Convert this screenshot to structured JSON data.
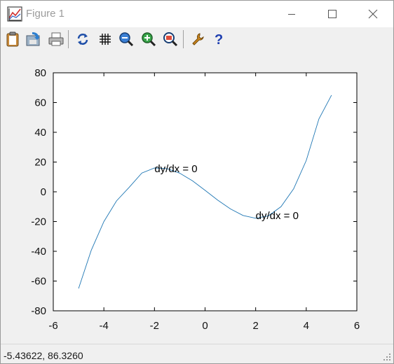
{
  "window": {
    "title": "Figure 1"
  },
  "titlebar_buttons": {
    "minimize": "minimize-icon",
    "maximize": "maximize-icon",
    "close": "close-icon"
  },
  "toolbar": {
    "items": [
      "copy-clipboard-icon",
      "save-icon",
      "print-icon",
      "refresh-icon",
      "grid-icon",
      "zoom-out-icon",
      "zoom-in-icon",
      "zoom-box-icon",
      "settings-wrench-icon",
      "help-icon"
    ]
  },
  "colors": {
    "line": "#1f77b4",
    "background": "#f0f0f0",
    "axes_face": "#ffffff"
  },
  "chart_data": {
    "type": "line",
    "title": "",
    "xlabel": "",
    "ylabel": "",
    "xlim": [
      -6,
      6
    ],
    "ylim": [
      -80,
      80
    ],
    "xticks": [
      "-6",
      "-4",
      "-2",
      "0",
      "2",
      "4",
      "6"
    ],
    "yticks": [
      "80",
      "60",
      "40",
      "20",
      "0",
      "-20",
      "-40",
      "-60",
      "-80"
    ],
    "grid": false,
    "series": [
      {
        "x": [
          -5,
          -4.5,
          -4,
          -3.5,
          -3,
          -2.5,
          -2,
          -1.5,
          -1,
          -0.5,
          0,
          0.5,
          1,
          1.5,
          2,
          2.5,
          3,
          3.5,
          4,
          4.5,
          5
        ],
        "y": [
          -65,
          -39.4,
          -20,
          -6.1,
          3.0,
          12.6,
          16,
          15.6,
          12.5,
          7.4,
          1,
          -5.6,
          -11.5,
          -15.9,
          -17.8,
          -16.2,
          -10,
          2,
          21,
          49,
          65
        ]
      }
    ],
    "annotations": [
      {
        "text": "dy/dx = 0",
        "x": -2,
        "y": 15.5
      },
      {
        "text": "dy/dx = 0",
        "x": 2,
        "y": -16
      }
    ]
  },
  "status": {
    "coords": "-5.43622,  86.3260"
  }
}
